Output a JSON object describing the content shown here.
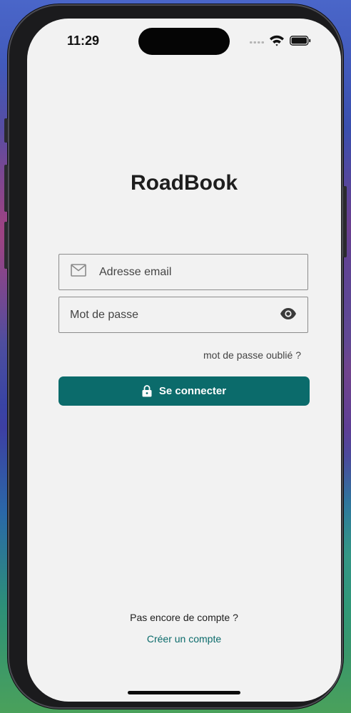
{
  "status_bar": {
    "time": "11:29",
    "icons": [
      "signal-icon",
      "wifi-icon",
      "battery-icon"
    ]
  },
  "app": {
    "title": "RoadBook"
  },
  "login_form": {
    "email": {
      "placeholder": "Adresse email",
      "value": "",
      "icon": "mail-icon"
    },
    "password": {
      "placeholder": "Mot de passe",
      "value": "",
      "icon": "eye-icon"
    },
    "forgot_password_label": "mot de passe oublié ?",
    "submit": {
      "label": "Se connecter",
      "icon": "lock-icon"
    }
  },
  "footer": {
    "no_account_text": "Pas encore de compte ?",
    "create_account_label": "Créer un compte"
  },
  "colors": {
    "primary": "#0b6b6b",
    "background": "#f2f2f2",
    "text": "#1e1e1e"
  }
}
